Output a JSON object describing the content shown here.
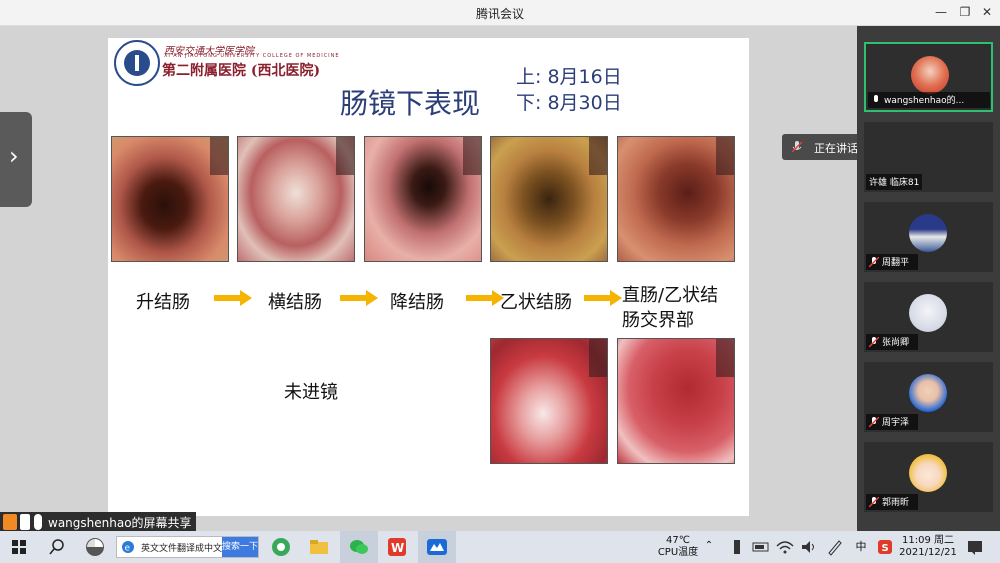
{
  "window": {
    "title": "腾讯会议"
  },
  "slide": {
    "logo_top": "西安交通大学医学院",
    "logo_sub": "XI'AN JIAOTONG UNIVERSITY COLLEGE OF MEDICINE",
    "hospital": "第二附属医院 (西北医院)",
    "title": "肠镜下表现",
    "date_top": "上: 8月16日",
    "date_bottom": "下: 8月30日",
    "labels": [
      "升结肠",
      "横结肠",
      "降结肠",
      "乙状结肠",
      "直肠/乙状结",
      "肠交界部"
    ],
    "no_scope": "未进镜"
  },
  "share": {
    "label": "wangshenhao的屏幕共享"
  },
  "participants": [
    {
      "name": "wangshenhao的..."
    },
    {
      "name": "许雄 临床81"
    },
    {
      "name": "周翻平"
    },
    {
      "name": "张尚卿"
    },
    {
      "name": "周宇泽"
    },
    {
      "name": "郭雨昕"
    }
  ],
  "speaking": {
    "label": "正在讲话:"
  },
  "taskbar": {
    "search_text": "英文文件翻译成中文",
    "search_button": "搜索一下",
    "temp": "47℃",
    "temp_label": "CPU温度",
    "ime": "中",
    "time": "11:09 周二",
    "date": "2021/12/21"
  },
  "colors": {
    "arrow": "#f5b400",
    "title_blue": "#2b3e78",
    "accent_green": "#2fbf71"
  }
}
